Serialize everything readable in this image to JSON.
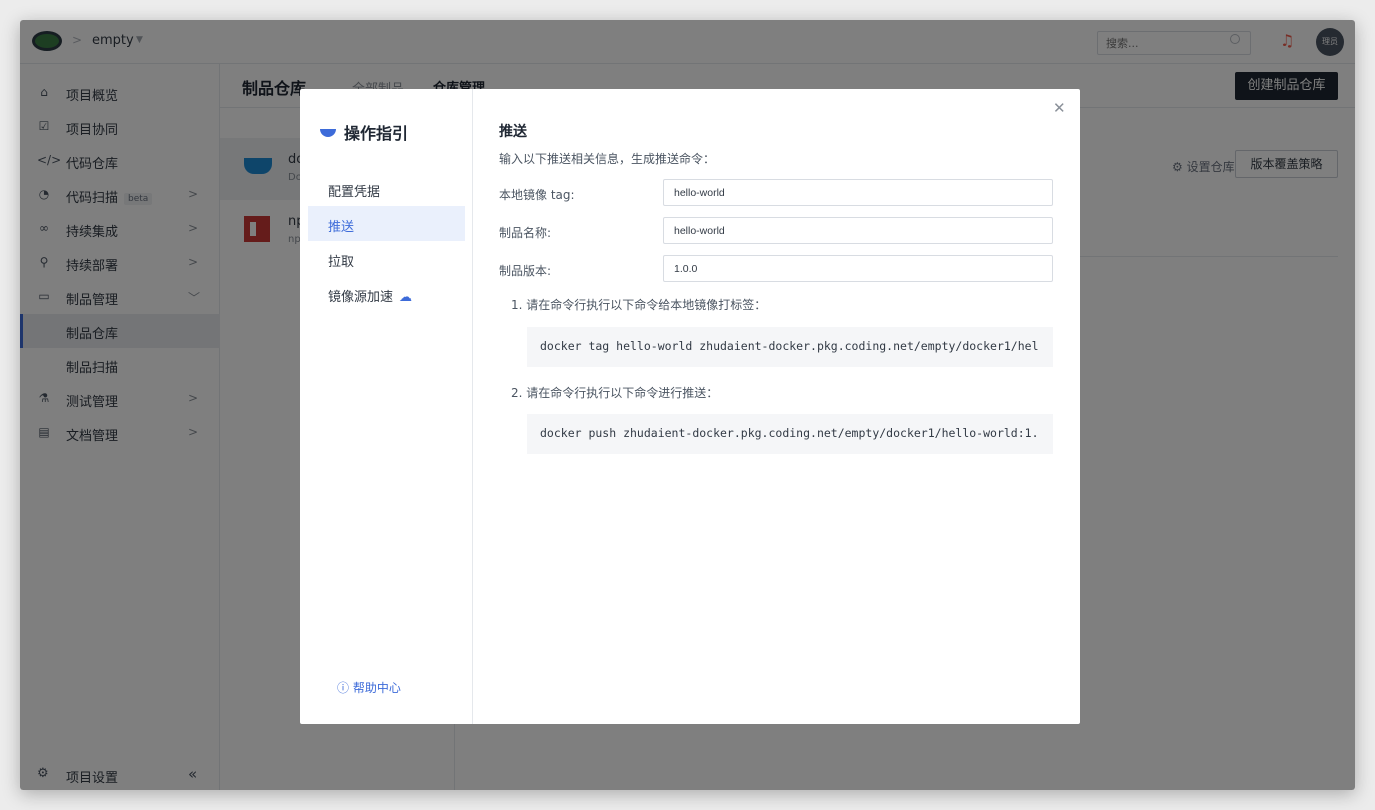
{
  "topbar": {
    "project_name": "empty",
    "search_placeholder": "搜索...",
    "avatar_text": "理员"
  },
  "sidebar": {
    "items": [
      {
        "label": "项目概览",
        "icon": "home-icon"
      },
      {
        "label": "项目协同",
        "icon": "checkbox-icon"
      },
      {
        "label": "代码仓库",
        "icon": "code-icon"
      },
      {
        "label": "代码扫描",
        "icon": "scan-icon",
        "badge": "beta"
      },
      {
        "label": "持续集成",
        "icon": "infinity-icon"
      },
      {
        "label": "持续部署",
        "icon": "deploy-icon"
      },
      {
        "label": "制品管理",
        "icon": "artifact-icon"
      },
      {
        "label": "制品仓库"
      },
      {
        "label": "制品扫描"
      },
      {
        "label": "测试管理",
        "icon": "test-icon"
      },
      {
        "label": "文档管理",
        "icon": "doc-icon"
      }
    ],
    "settings_label": "项目设置"
  },
  "content": {
    "title": "制品仓库",
    "tab_all": "全部制品",
    "tab_manage": "仓库管理",
    "create_button": "创建制品仓库",
    "repos": [
      {
        "name": "do",
        "sub": "Do"
      },
      {
        "name": "np",
        "sub": "np"
      }
    ],
    "settings_link": "设置仓库",
    "policy_button": "版本覆盖策略"
  },
  "modal": {
    "title": "操作指引",
    "nav": [
      "配置凭据",
      "推送",
      "拉取",
      "镜像源加速"
    ],
    "help": "帮助中心",
    "section_title": "推送",
    "intro": "输入以下推送相关信息，生成推送命令：",
    "fields": [
      {
        "label": "本地镜像 tag:",
        "value": "hello-world"
      },
      {
        "label": "制品名称:",
        "value": "hello-world"
      },
      {
        "label": "制品版本:",
        "value": "1.0.0"
      }
    ],
    "step1": "1. 请在命令行执行以下命令给本地镜像打标签：",
    "cmd1": "docker tag hello-world zhudaient-docker.pkg.coding.net/empty/docker1/hel",
    "step2": "2. 请在命令行执行以下命令进行推送：",
    "cmd2": "docker push zhudaient-docker.pkg.coding.net/empty/docker1/hello-world:1."
  }
}
